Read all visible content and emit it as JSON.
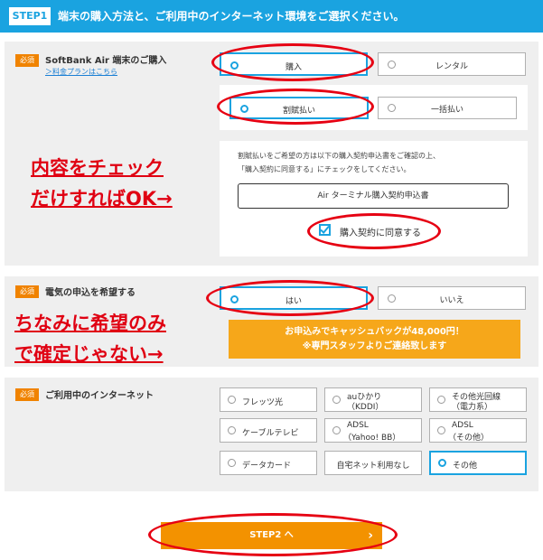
{
  "header": {
    "step_badge": "STEP1",
    "title": "端末の購入方法と、ご利用中のインターネット環境をご選択ください。"
  },
  "required_label": "必須",
  "purchase": {
    "title": "SoftBank Air 端末のご購入",
    "link": "＞料金プランはこちら",
    "options": [
      {
        "label": "購入",
        "selected": true
      },
      {
        "label": "レンタル",
        "selected": false
      }
    ],
    "payment_options": [
      {
        "label": "割賦払い",
        "selected": true
      },
      {
        "label": "一括払い",
        "selected": false
      }
    ],
    "notice_lines": [
      "割賦払いをご希望の方は以下の購入契約申込書をご確認の上、",
      "「購入契約に同意する」にチェックをしてください。"
    ],
    "doc_button": "Air ターミナル購入契約申込書",
    "agree_label": "購入契約に同意する",
    "agree_checked": true
  },
  "electricity": {
    "title": "電気の申込を希望する",
    "options": [
      {
        "label": "はい",
        "selected": true
      },
      {
        "label": "いいえ",
        "selected": false
      }
    ],
    "cashback_line1": "お申込みでキャッシュバックが48,000円！",
    "cashback_line2": "※専門スタッフよりご連絡致します"
  },
  "internet": {
    "title": "ご利用中のインターネット",
    "options": [
      {
        "line1": "フレッツ光",
        "line2": "",
        "selected": false
      },
      {
        "line1": "auひかり",
        "line2": "（KDDI）",
        "selected": false
      },
      {
        "line1": "その他光回線",
        "line2": "（電力系）",
        "selected": false
      },
      {
        "line1": "ケーブルテレビ",
        "line2": "",
        "selected": false
      },
      {
        "line1": "ADSL",
        "line2": "（Yahoo! BB）",
        "selected": false
      },
      {
        "line1": "ADSL",
        "line2": "（その他）",
        "selected": false
      },
      {
        "line1": "データカード",
        "line2": "",
        "selected": false
      },
      {
        "line1": "自宅ネット利用なし",
        "line2": "",
        "selected": false
      },
      {
        "line1": "その他",
        "line2": "",
        "selected": true
      }
    ]
  },
  "annotations": {
    "a1_line1": "内容をチェック",
    "a1_line2": "だけすればOK→",
    "a2_line1": "ちなみに希望のみ",
    "a2_line2": "で確定じゃない→"
  },
  "step2_button": {
    "label": "STEP2 へ",
    "chevron": "›"
  },
  "colors": {
    "accent": "#1aa3e0",
    "required": "#f08300",
    "cashback": "#f6a71a",
    "annotation": "#e60012",
    "step2": "#f39200"
  }
}
